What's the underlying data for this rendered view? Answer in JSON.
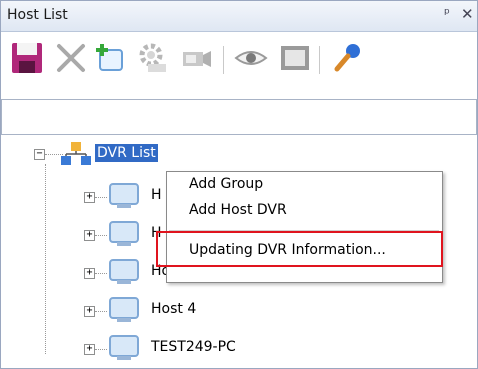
{
  "window": {
    "title": "Host List",
    "pin_glyph": "ᵖ",
    "close_glyph": "✕"
  },
  "toolbar": {
    "buttons": [
      {
        "name": "save-icon"
      },
      {
        "name": "delete-icon"
      },
      {
        "name": "add-group-icon"
      },
      {
        "name": "settings-icon"
      },
      {
        "name": "camera-icon"
      },
      {
        "name": "eye-icon"
      },
      {
        "name": "screen-icon"
      },
      {
        "name": "microphone-icon"
      }
    ]
  },
  "tree": {
    "root": {
      "label": "DVR List",
      "expander": "−"
    },
    "hosts": [
      {
        "label": "H",
        "expander": "+"
      },
      {
        "label": "H",
        "expander": "+"
      },
      {
        "label": "Host 3",
        "expander": "+"
      },
      {
        "label": "Host 4",
        "expander": "+"
      },
      {
        "label": "TEST249-PC",
        "expander": "+"
      }
    ]
  },
  "context_menu": {
    "items": [
      {
        "label": "Add Group"
      },
      {
        "label": "Add Host DVR"
      },
      {
        "label": "Updating DVR Information..."
      }
    ],
    "highlight_color": "#e0141e"
  },
  "colors": {
    "selection": "#316ac5",
    "border": "#9aa7c0"
  }
}
